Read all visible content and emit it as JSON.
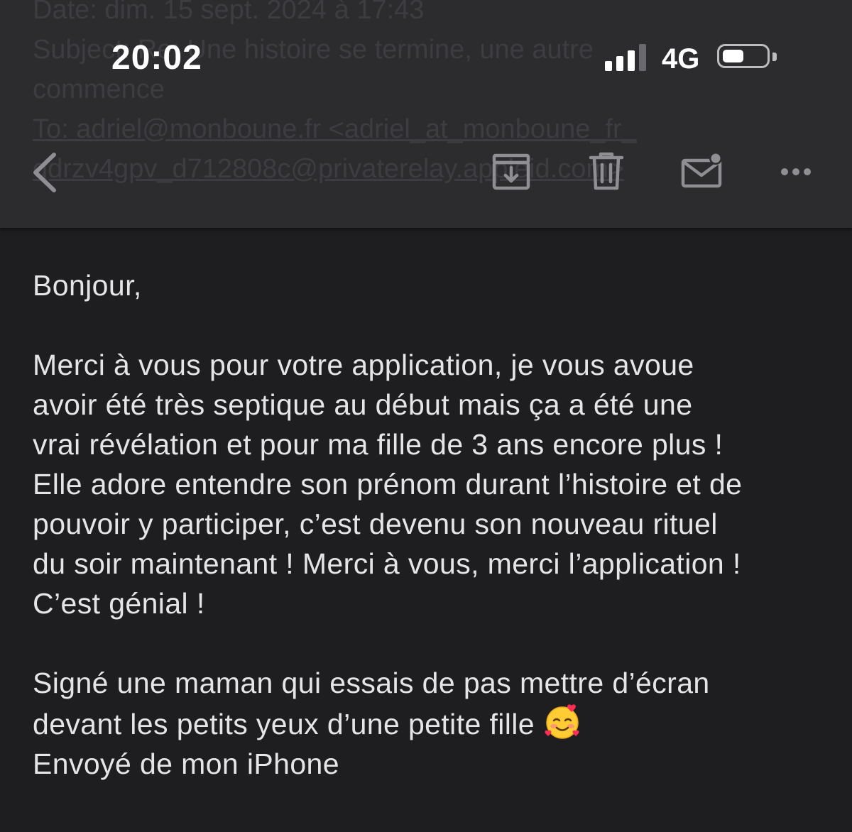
{
  "header": {
    "ghost_lines": [
      "Date: dim. 15 sept. 2024 à 17:43",
      "Subject: Re: Une histoire se termine, une autre commence",
      "commence",
      "To: adriel@monboune.fr <adriel_at_monboune_fr_",
      "qdrzv4gpv_d712808c@privaterelay.appleid.com>"
    ]
  },
  "status_bar": {
    "time": "20:02",
    "network": "4G",
    "signal_bars": 3,
    "battery_level": 0.5
  },
  "toolbar": {
    "back_icon": "chevron-left-icon",
    "archive_icon": "archive-box-icon",
    "trash_icon": "trash-icon",
    "mark_unread_icon": "envelope-unread-icon",
    "more_icon": "ellipsis-icon"
  },
  "email": {
    "greeting": "Bonjour,",
    "paragraph_lines": [
      "Merci à vous pour votre application, je vous avoue",
      "avoir été très septique au début mais ça a été une",
      "vrai révélation et pour ma fille de 3 ans encore plus !",
      "Elle adore entendre son prénom durant l’histoire et de",
      "pouvoir y participer, c’est devenu son nouveau rituel",
      "du soir maintenant ! Merci à vous, merci l’application !",
      "C’est génial !"
    ],
    "signature_line1": "Signé une maman qui essais de pas mettre d’écran",
    "signature_line2": "devant les petits yeux d’une petite fille",
    "emoji": "smiling-face-with-hearts-icon",
    "sent_from": "Envoyé de mon iPhone"
  },
  "colors": {
    "header_bg": "#2c2c2e",
    "body_bg": "#1e1e21",
    "text": "#e5e5e7",
    "icon": "#8e8e93"
  }
}
